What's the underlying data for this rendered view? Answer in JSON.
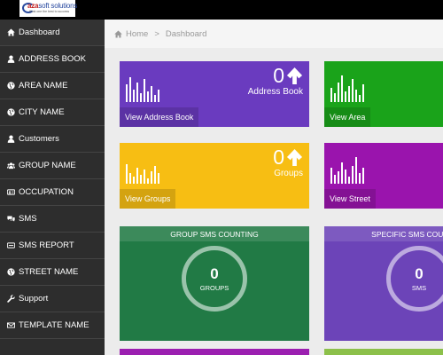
{
  "header": {
    "logo_text_prefix": "aza",
    "logo_text_suffix": "soft solutions",
    "logo_tagline": "think one the best to success"
  },
  "sidebar": {
    "items": [
      {
        "label": "Dashboard",
        "icon": "home-icon"
      },
      {
        "label": "ADDRESS BOOK",
        "icon": "user-icon"
      },
      {
        "label": "AREA NAME",
        "icon": "globe-icon"
      },
      {
        "label": "CITY NAME",
        "icon": "globe-icon"
      },
      {
        "label": "Customers",
        "icon": "user-icon"
      },
      {
        "label": "GROUP NAME",
        "icon": "users-icon"
      },
      {
        "label": "OCCUPATION",
        "icon": "id-card-icon"
      },
      {
        "label": "SMS",
        "icon": "comments-icon"
      },
      {
        "label": "SMS REPORT",
        "icon": "sms-report-icon"
      },
      {
        "label": "STREET NAME",
        "icon": "globe-icon"
      },
      {
        "label": "Support",
        "icon": "wrench-icon"
      },
      {
        "label": "TEMPLATE NAME",
        "icon": "envelope-icon"
      }
    ]
  },
  "breadcrumb": {
    "home": "Home",
    "separator": ">",
    "current": "Dashboard"
  },
  "tiles": [
    {
      "count": "0",
      "title": "Address Book",
      "link": "View Address Book",
      "color": "#6a3bbf"
    },
    {
      "count": "",
      "title": "",
      "link": "View Area",
      "color": "#1aa31a"
    },
    {
      "count": "0",
      "title": "Groups",
      "link": "View Groups",
      "color": "#f7be13"
    },
    {
      "count": "",
      "title": "",
      "link": "View Street",
      "color": "#9a14ad"
    }
  ],
  "panels": [
    {
      "heading": "GROUP SMS COUNTING",
      "value": "0",
      "label": "GROUPS",
      "color": "#217a45"
    },
    {
      "heading": "SPECIFIC SMS COUNTING",
      "value": "0",
      "label": "SMS",
      "color": "#6c44b8"
    }
  ],
  "colors": {
    "topbar": "#000000",
    "sidebar": "#2d2d2d",
    "content_bg": "#ececec",
    "bottom_left_strip": "#9b1fb0",
    "bottom_right_strip": "#8cc04a"
  }
}
